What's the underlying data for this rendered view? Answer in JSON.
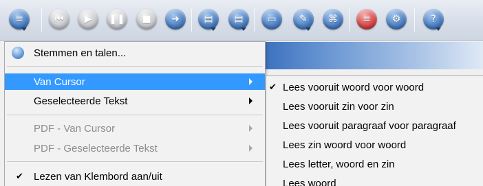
{
  "toolbar": {
    "buttons": [
      {
        "name": "speech-menu-button",
        "icon": "speech-bubble-icon",
        "style": "blue",
        "glyph": "≡",
        "dropdown": true
      },
      {
        "name": "previous-button",
        "icon": "skip-back-icon",
        "style": "grey",
        "glyph": "⏮"
      },
      {
        "name": "play-button",
        "icon": "play-icon",
        "style": "grey",
        "glyph": "▶"
      },
      {
        "name": "pause-button",
        "icon": "pause-icon",
        "style": "grey",
        "glyph": "❚❚"
      },
      {
        "name": "stop-button",
        "icon": "stop-icon",
        "style": "grey",
        "glyph": "■"
      },
      {
        "name": "speed-button",
        "icon": "speed-icon",
        "style": "blue",
        "glyph": "➜"
      },
      {
        "name": "save-audio-button",
        "icon": "document-audio-icon",
        "style": "blue",
        "glyph": "▤",
        "dropdown": true
      },
      {
        "name": "record-button",
        "icon": "record-icon",
        "style": "blue",
        "glyph": "▤",
        "dropdown": true
      },
      {
        "name": "screen-reader-button",
        "icon": "monitor-icon",
        "style": "blue",
        "glyph": "▭"
      },
      {
        "name": "scan-button",
        "icon": "scan-icon",
        "style": "blue",
        "glyph": "✎",
        "dropdown": true
      },
      {
        "name": "dictionary-button",
        "icon": "book-icon",
        "style": "blue",
        "glyph": "⌘"
      },
      {
        "name": "language-button",
        "icon": "flag-icon",
        "style": "red",
        "glyph": "≡"
      },
      {
        "name": "settings-button",
        "icon": "wrench-icon",
        "style": "blue",
        "glyph": "⚙"
      },
      {
        "name": "help-button",
        "icon": "help-icon",
        "style": "blue",
        "glyph": "?",
        "dropdown": true
      }
    ]
  },
  "menu": {
    "voices_label": "Stemmen en talen...",
    "from_cursor_label": "Van Cursor",
    "selected_text_label": "Geselecteerde Tekst",
    "pdf_from_cursor_label": "PDF - Van Cursor",
    "pdf_selected_text_label": "PDF - Geselecteerde Tekst",
    "clipboard_label": "Lezen van Klembord aan/uit"
  },
  "submenu": {
    "items": [
      {
        "label": "Lees vooruit woord voor woord",
        "checked": true
      },
      {
        "label": "Lees vooruit zin voor zin",
        "checked": false
      },
      {
        "label": "Lees vooruit paragraaf voor paragraaf",
        "checked": false
      },
      {
        "label": "Lees zin woord voor woord",
        "checked": false
      },
      {
        "label": "Lees letter, woord en zin",
        "checked": false
      },
      {
        "label": "Lees woord",
        "checked": false
      }
    ]
  },
  "colors": {
    "highlight": "#3399ff",
    "menu_background": "#f2f2f2",
    "disabled_text": "#8d8d8d"
  }
}
